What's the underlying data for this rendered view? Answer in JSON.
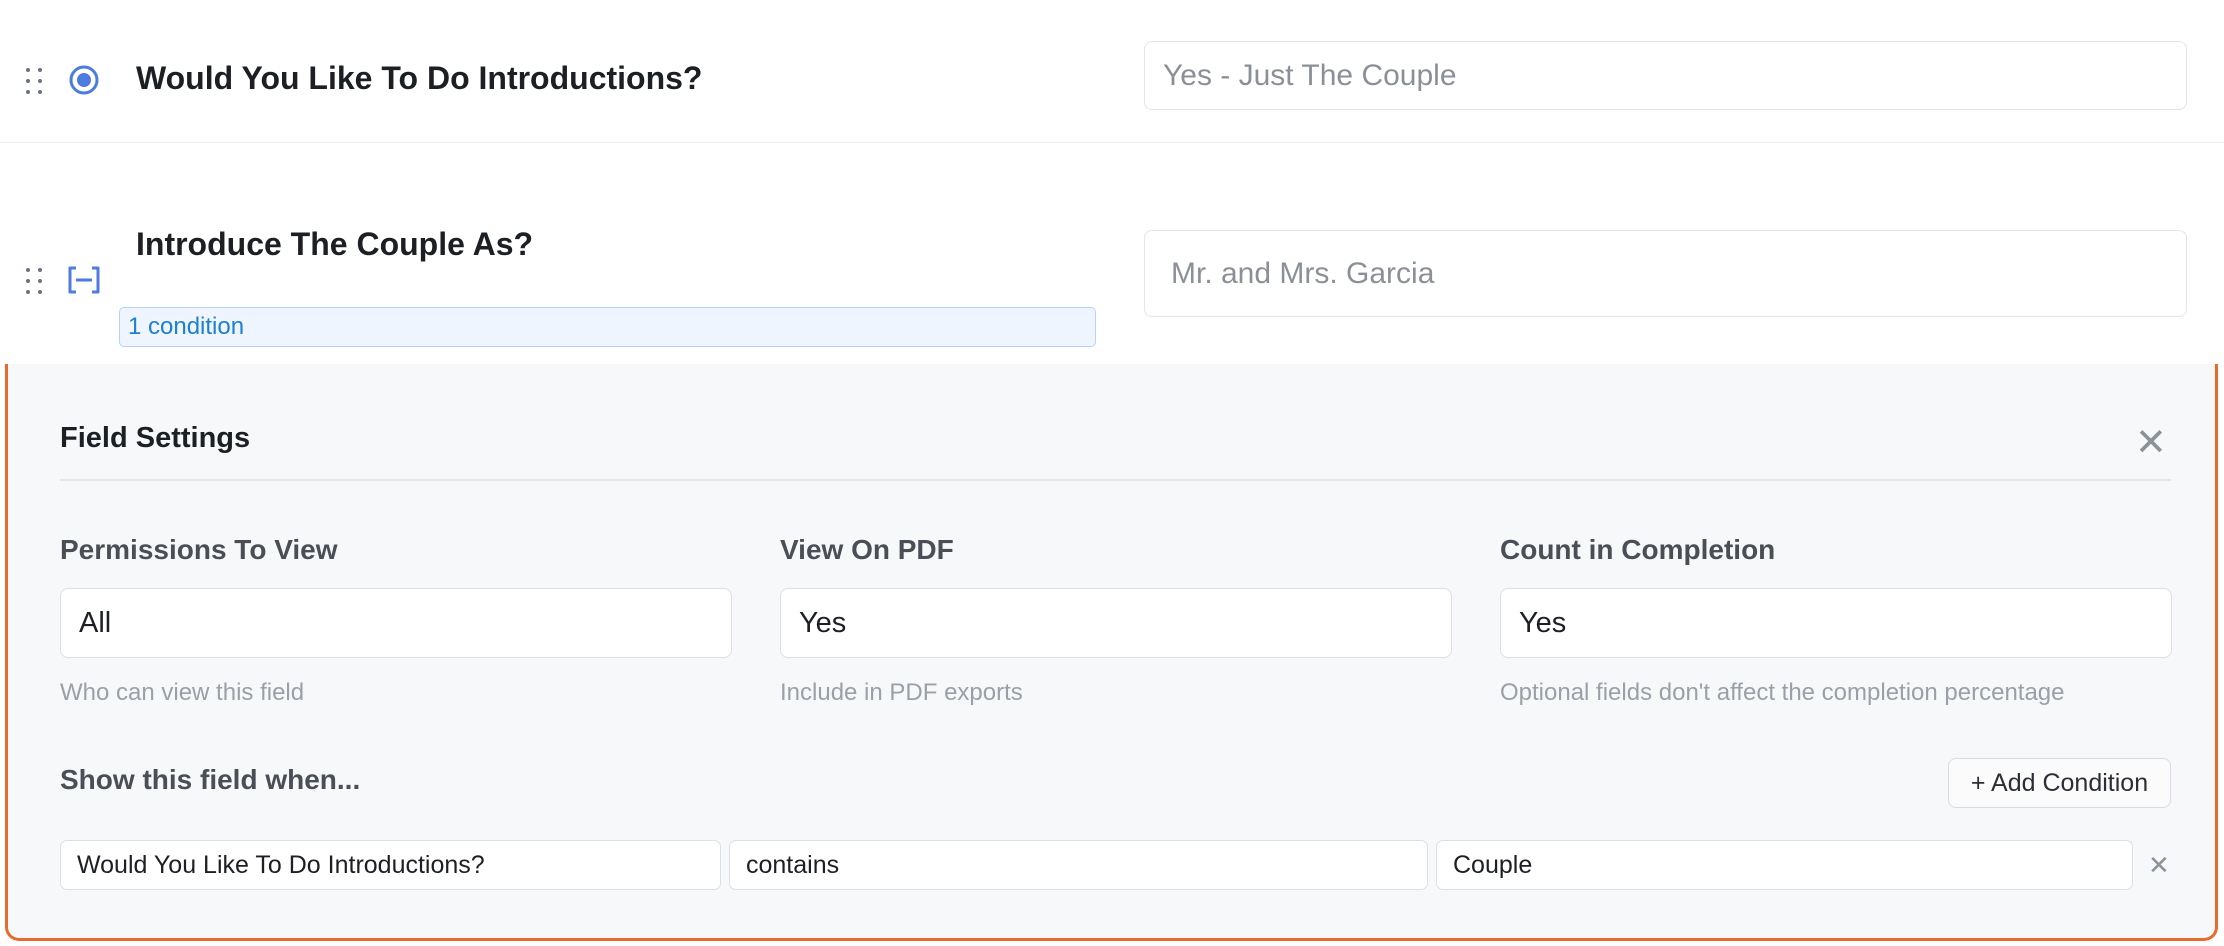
{
  "fields": [
    {
      "title": "Would You Like To Do Introductions?",
      "type_icon": "radio-icon",
      "value": "Yes - Just The Couple"
    },
    {
      "title": "Introduce The Couple As?",
      "type_icon": "text-field-icon",
      "value": "Mr. and Mrs. Garcia",
      "condition_badge": "1 condition"
    }
  ],
  "settings": {
    "title": "Field Settings",
    "permissions": {
      "label": "Permissions To View",
      "value": "All",
      "help": "Who can view this field"
    },
    "view_on_pdf": {
      "label": "View On PDF",
      "value": "Yes",
      "help": "Include in PDF exports"
    },
    "count_in_completion": {
      "label": "Count in Completion",
      "value": "Yes",
      "help": "Optional fields don't affect the completion percentage"
    },
    "conditions": {
      "heading": "Show this field when...",
      "add_label": "+ Add Condition",
      "rows": [
        {
          "field": "Would You Like To Do Introductions?",
          "operator": "contains",
          "value": "Couple"
        }
      ]
    }
  },
  "colors": {
    "accent_blue": "#4f7be0",
    "panel_border": "#e86a2c",
    "badge_text": "#1f7fd0"
  }
}
